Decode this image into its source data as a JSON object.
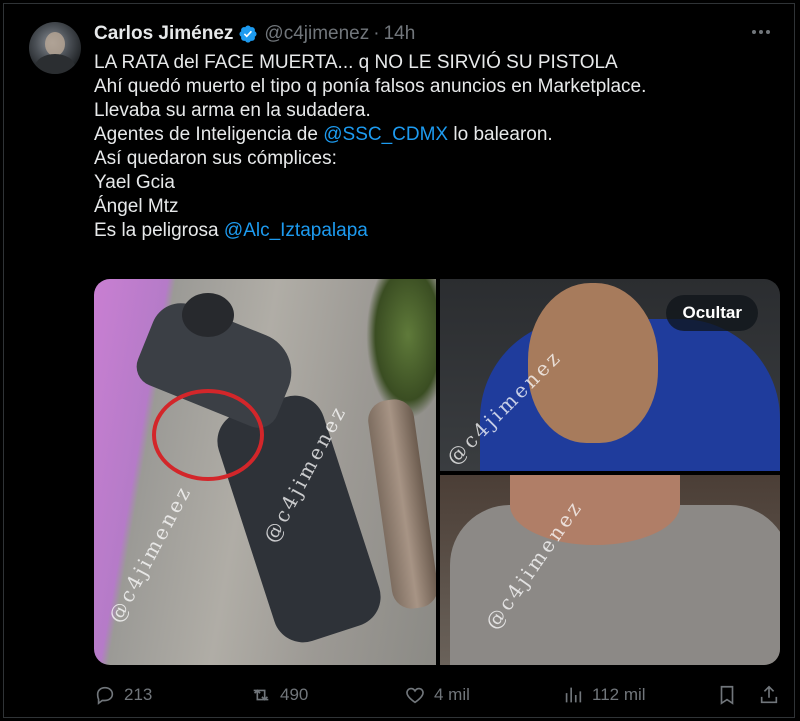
{
  "tweet": {
    "author_name": "Carlos Jiménez",
    "handle": "@c4jimenez",
    "separator": "·",
    "time": "14h",
    "lines": [
      "LA RATA del FACE MUERTA... q NO LE SIRVIÓ SU PISTOLA",
      "Ahí quedó muerto el tipo q ponía falsos anuncios en Marketplace.",
      "Llevaba su arma en la sudadera."
    ],
    "line4_prefix": "Agentes de Inteligencia de ",
    "line4_mention": "@SSC_CDMX",
    "line4_suffix": " lo balearon.",
    "lines_b": [
      "Así quedaron sus cómplices:",
      "Yael Gcia",
      "Ángel Mtz"
    ],
    "line8_prefix": "Es la peligrosa ",
    "line8_mention": "@Alc_Iztapalapa"
  },
  "media": {
    "watermark": "@c4jimenez",
    "hide_label": "Ocultar"
  },
  "actions": {
    "replies": "213",
    "reposts": "490",
    "likes": "4 mil",
    "views": "112 mil"
  },
  "colors": {
    "accent": "#1d9bf0",
    "muted": "#71767b",
    "text": "#e7e9ea"
  },
  "icons": [
    "verified-icon",
    "more-icon",
    "reply-icon",
    "repost-icon",
    "like-icon",
    "views-icon",
    "bookmark-icon",
    "share-icon"
  ]
}
